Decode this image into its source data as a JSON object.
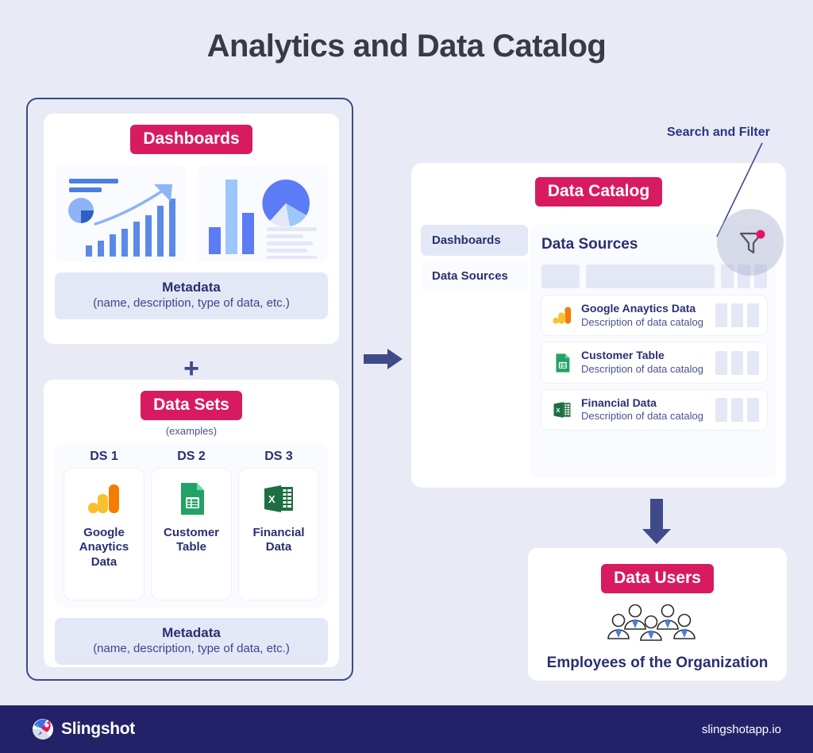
{
  "page": {
    "title": "Analytics and Data Catalog",
    "background_color": "#e8eaf6",
    "accent_color": "#d81b60",
    "navy_color": "#2a2f70"
  },
  "left_panel": {
    "dashboards": {
      "pill_label": "Dashboards",
      "metadata_title": "Metadata",
      "metadata_subtitle": "(name, description, type of data, etc.)"
    },
    "plus_symbol": "+",
    "data_sets": {
      "pill_label": "Data Sets",
      "examples_label": "(examples)",
      "items": [
        {
          "ds_label": "DS 1",
          "name": "Google\nAnaytics\nData",
          "icon": "google-analytics-icon"
        },
        {
          "ds_label": "DS 2",
          "name": "Customer\nTable",
          "icon": "google-sheets-icon"
        },
        {
          "ds_label": "DS 3",
          "name": "Financial\nData",
          "icon": "excel-icon"
        }
      ],
      "metadata_title": "Metadata",
      "metadata_subtitle": "(name, description, type of data, etc.)"
    }
  },
  "catalog": {
    "pill_label": "Data Catalog",
    "tabs": [
      {
        "label": "Dashboards",
        "active": true
      },
      {
        "label": "Data Sources",
        "active": false
      }
    ],
    "heading": "Data Sources",
    "rows": [
      {
        "title": "Google Anaytics Data",
        "description": "Description of data catalog",
        "icon": "google-analytics-icon"
      },
      {
        "title": "Customer Table",
        "description": "Description of data catalog",
        "icon": "google-sheets-icon"
      },
      {
        "title": "Financial Data",
        "description": "Description of data catalog",
        "icon": "excel-icon"
      }
    ],
    "annotation_label": "Search and Filter",
    "filter_icon": "filter-funnel-icon"
  },
  "data_users": {
    "pill_label": "Data Users",
    "caption": "Employees of the Organization",
    "icon": "group-of-people-icon"
  },
  "arrows": {
    "right": "arrow-right-icon",
    "down": "arrow-down-icon"
  },
  "footer": {
    "brand_name": "Slingshot",
    "url": "slingshotapp.io",
    "logo": "slingshot-logo-icon",
    "background_color": "#232269"
  }
}
